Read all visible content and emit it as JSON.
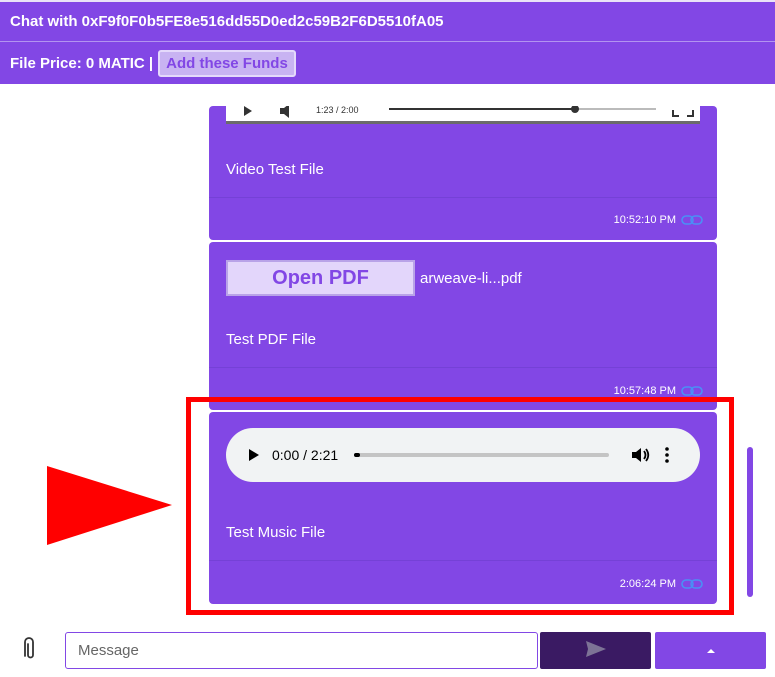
{
  "header": {
    "chat_title": "Chat with 0xF9f0F0b5FE8e516dd55D0ed2c59B2F6D5510fA05",
    "file_price_label": "File Price: 0 MATIC |",
    "add_funds_label": "Add these Funds"
  },
  "messages": [
    {
      "type": "video",
      "video_time": "1:23  /  2:00",
      "video_progress": 0.62,
      "caption": "Video Test File",
      "timestamp": "10:52:10 PM",
      "link_icon": "link-icon"
    },
    {
      "type": "pdf",
      "open_label": "Open PDF",
      "file_name": "arweave-li...pdf",
      "caption": "Test PDF File",
      "timestamp": "10:57:48 PM",
      "link_icon": "link-icon"
    },
    {
      "type": "audio",
      "audio_time": "0:00 / 2:21",
      "audio_progress": 0.0,
      "caption": "Test Music File",
      "timestamp": "2:06:24 PM",
      "link_icon": "link-icon"
    }
  ],
  "composer": {
    "placeholder": "Message",
    "attach_icon": "paperclip-icon",
    "send_icon": "send-icon",
    "more_icon": "caret-up-icon"
  },
  "annotations": {
    "highlight_color": "#ff0000",
    "arrow_color": "#ff0000"
  },
  "colors": {
    "accent": "#8247e5",
    "send_button": "#3a1a63"
  }
}
